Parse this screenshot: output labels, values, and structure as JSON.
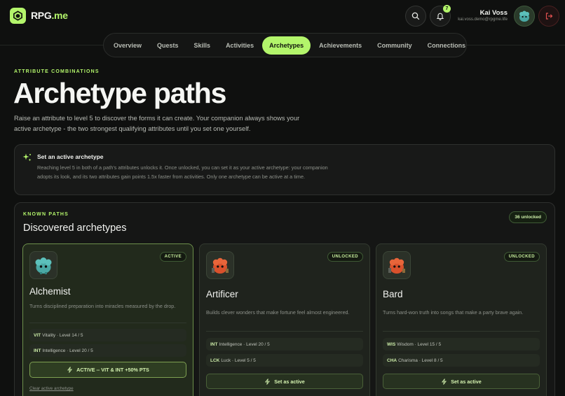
{
  "app": {
    "name_main": "RPG",
    "name_suffix": ".me"
  },
  "colors": {
    "accent": "#b3f56b",
    "background": "#0f100f",
    "danger": "#e05050"
  },
  "header": {
    "notification_count": "7",
    "user_name": "Kai Voss",
    "user_email": "kai.voss.demo@rpgme.life",
    "icons": [
      "search-icon",
      "bell-icon",
      "logout-icon"
    ]
  },
  "nav": {
    "items": [
      "Overview",
      "Quests",
      "Skills",
      "Activities",
      "Archetypes",
      "Achievements",
      "Community",
      "Connections"
    ],
    "active": "Archetypes"
  },
  "hero": {
    "eyebrow": "ATTRIBUTE COMBINATIONS",
    "title": "Archetype paths",
    "lead": "Raise an attribute to level 5 to discover the forms it can create. Your companion always shows your active archetype - the two strongest qualifying attributes until you set one yourself."
  },
  "info": {
    "title": "Set an active archetype",
    "body": "Reaching level 5 in both of a path's attributes unlocks it. Once unlocked, you can set it as your active archetype: your companion adopts its look, and its two attributes gain points 1.5x faster from activities. Only one archetype can be active at a time."
  },
  "panel": {
    "eyebrow": "KNOWN PATHS",
    "title": "Discovered archetypes",
    "count": "36 unlocked"
  },
  "cards": [
    {
      "name": "Alchemist",
      "status": "ACTIVE",
      "desc": "Turns disciplined preparation into miracles measured by the drop.",
      "attrs": [
        {
          "code": "VIT",
          "text": "Vitality · Level 14 / 5"
        },
        {
          "code": "INT",
          "text": "Intelligence · Level 20 / 5"
        }
      ],
      "button": "ACTIVE --  VIT & INT +50% PTS",
      "link": "Clear active archetype"
    },
    {
      "name": "Artificer",
      "status": "UNLOCKED",
      "desc": "Builds clever wonders that make fortune feel almost engineered.",
      "attrs": [
        {
          "code": "INT",
          "text": "Intelligence · Level 20 / 5"
        },
        {
          "code": "LCK",
          "text": "Luck · Level 5 / 5"
        }
      ],
      "button": "Set as active"
    },
    {
      "name": "Bard",
      "status": "UNLOCKED",
      "desc": "Turns hard-won truth into songs that make a party brave again.",
      "attrs": [
        {
          "code": "WIS",
          "text": "Wisdom · Level 15 / 5"
        },
        {
          "code": "CHA",
          "text": "Charisma · Level 8 / 5"
        }
      ],
      "button": "Set as active"
    }
  ]
}
